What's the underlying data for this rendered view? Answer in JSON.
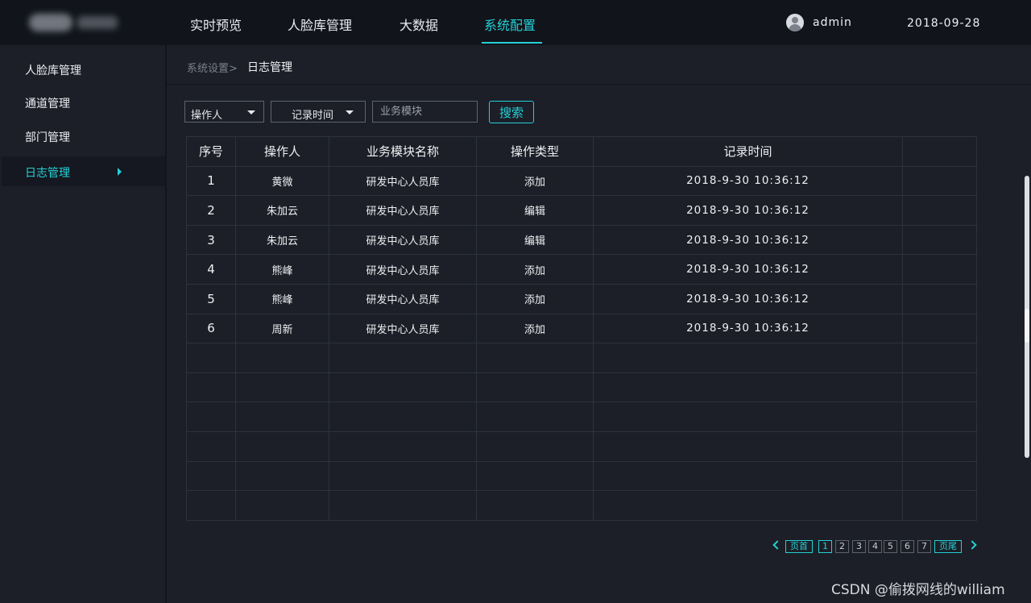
{
  "header": {
    "nav": [
      "实时预览",
      "人脸库管理",
      "大数据",
      "系统配置"
    ],
    "active_nav": "系统配置",
    "username": "admin",
    "date": "2018-09-28"
  },
  "sidebar": {
    "items": [
      {
        "label": "人脸库管理"
      },
      {
        "label": "通道管理"
      },
      {
        "label": "部门管理"
      },
      {
        "label": "日志管理"
      }
    ],
    "active": "日志管理"
  },
  "breadcrumb": {
    "parent": "系统设置>",
    "current": "日志管理"
  },
  "filters": {
    "operator_select": "操作人",
    "time_select": "记录时间",
    "module_placeholder": "业务模块",
    "search_label": "搜索"
  },
  "table": {
    "headers": [
      "序号",
      "操作人",
      "业务模块名称",
      "操作类型",
      "记录时间",
      ""
    ],
    "rows": [
      [
        "1",
        "黄微",
        "研发中心人员库",
        "添加",
        "2018-9-30  10:36:12"
      ],
      [
        "2",
        "朱加云",
        "研发中心人员库",
        "编辑",
        "2018-9-30  10:36:12"
      ],
      [
        "3",
        "朱加云",
        "研发中心人员库",
        "编辑",
        "2018-9-30  10:36:12"
      ],
      [
        "4",
        "熊峰",
        "研发中心人员库",
        "添加",
        "2018-9-30  10:36:12"
      ],
      [
        "5",
        "熊峰",
        "研发中心人员库",
        "添加",
        "2018-9-30  10:36:12"
      ],
      [
        "6",
        "周新",
        "研发中心人员库",
        "添加",
        "2018-9-30  10:36:12"
      ]
    ],
    "empty_rows": 6
  },
  "pagination": {
    "first": "页首",
    "last": "页尾",
    "pages": [
      "1",
      "2",
      "3",
      "4",
      "5",
      "6",
      "7"
    ],
    "current": "1"
  },
  "watermark": "CSDN @偷拨网线的william",
  "colors": {
    "accent": "#25d0d6",
    "background": "#1c1f27",
    "topbar": "#11141b"
  }
}
